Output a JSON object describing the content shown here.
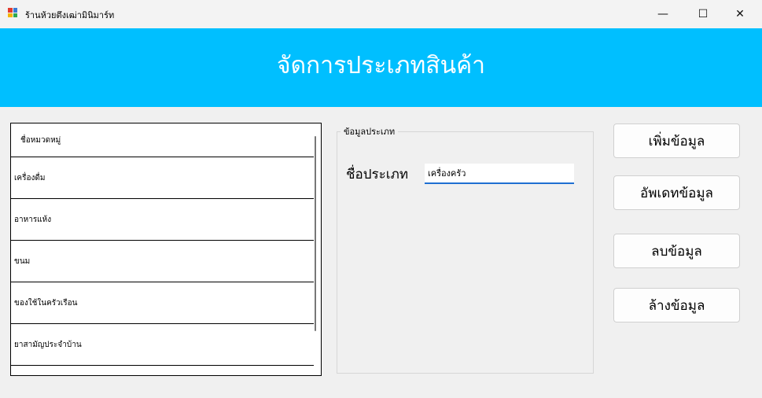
{
  "window": {
    "title": "ร้านห้วยตึงเฒ่ามินิมาร์ท",
    "minimize_glyph": "—",
    "maximize_glyph": "☐",
    "close_glyph": "✕"
  },
  "header": {
    "title": "จัดการประเภทสินค้า",
    "background": "#00bfff"
  },
  "list": {
    "column_header": "ชื่อหมวดหมู่",
    "items": [
      "เครื่องดื่ม",
      "อาหารแห้ง",
      "ขนม",
      "ของใช้ในครัวเรือน",
      "ยาสามัญประจำบ้าน"
    ]
  },
  "group": {
    "legend": "ข้อมูลประเภท",
    "type_label": "ชื่อประเภท",
    "type_value": "เครื่องครัว"
  },
  "buttons": {
    "add": "เพิ่มข้อมูล",
    "update": "อัพเดทข้อมูล",
    "delete": "ลบข้อมูล",
    "clear": "ล้างข้อมูล"
  }
}
